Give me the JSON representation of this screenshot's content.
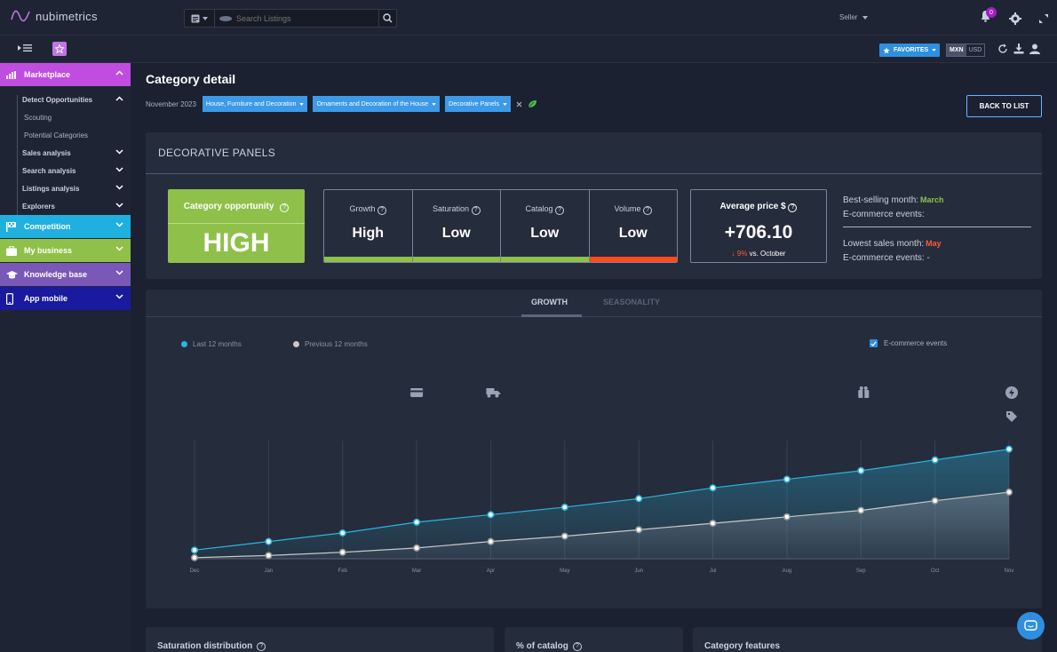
{
  "app": {
    "logo_text": "nubimetrics"
  },
  "topbar": {
    "search_placeholder": "Search Listings",
    "seller_label": "Seller",
    "notifications_count": "0"
  },
  "subbar": {
    "favorites_label": "FAVORITES",
    "currency_active": "MXN",
    "currency_other": "USD"
  },
  "sidebar": {
    "marketplace": "Marketplace",
    "detect_opportunities": "Detect Opportunities",
    "scouting": "Scouting",
    "potential_categories": "Potential Categories",
    "sales_analysis": "Sales analysis",
    "search_analysis": "Search analysis",
    "listings_analysis": "Listings analysis",
    "explorers": "Explorers",
    "competition": "Competition",
    "my_business": "My business",
    "knowledge_base": "Knowledge base",
    "app_mobile": "App mobile"
  },
  "main": {
    "title": "Category detail",
    "date": "November 2023",
    "crumbs": [
      "House, Furniture and Decoration",
      "Ornaments and Decoration of the House",
      "Decorative Panels"
    ],
    "back_label": "BACK TO LIST"
  },
  "summary": {
    "title": "DECORATIVE PANELS",
    "opportunity_label": "Category opportunity",
    "opportunity_value": "HIGH",
    "metrics": [
      {
        "label": "Growth",
        "value": "High"
      },
      {
        "label": "Saturation",
        "value": "Low"
      },
      {
        "label": "Catalog",
        "value": "Low"
      },
      {
        "label": "Volume",
        "value": "Low"
      }
    ],
    "avg_label": "Average price $",
    "avg_value": "+706.10",
    "avg_delta_pct": "9%",
    "avg_delta_text": "vs. October",
    "best_label": "Best-selling month:",
    "best_value": "March",
    "events_label": "E-commerce events:",
    "best_events_value": "-",
    "lowest_label": "Lowest sales month:",
    "lowest_value": "May",
    "lowest_events_value": "-"
  },
  "colors": {
    "accent_green": "#8fc04a",
    "accent_red": "#ff5a3c",
    "series_current": "#29b6e0",
    "series_previous": "#c8c8c8"
  },
  "chart_tabs": {
    "growth": "GROWTH",
    "seasonality": "SEASONALITY"
  },
  "chart_data": {
    "type": "area",
    "x": [
      "Dec",
      "Jan",
      "Feb",
      "Mar",
      "Apr",
      "May",
      "Jun",
      "Jul",
      "Aug",
      "Sep",
      "Oct",
      "Nov"
    ],
    "series": [
      {
        "name": "Last 12 months",
        "values": [
          8,
          16,
          24,
          34,
          41,
          48,
          56,
          66,
          74,
          82,
          92,
          102
        ]
      },
      {
        "name": "Previous 12 months",
        "values": [
          1,
          3,
          6,
          10,
          16,
          21,
          27,
          33,
          39,
          45,
          54,
          62
        ]
      }
    ],
    "ylim": [
      0,
      110
    ],
    "legend_position": "top-left",
    "events_checkbox_label": "E-commerce events",
    "event_icons": [
      {
        "month": "Mar",
        "icon": "credit-card-icon"
      },
      {
        "month": "Apr",
        "icon": "delivery-truck-icon"
      },
      {
        "month": "Sep",
        "icon": "gift-icon"
      },
      {
        "month": "Nov",
        "icon": "flash-icon"
      },
      {
        "month": "Nov",
        "icon": "tag-icon"
      }
    ]
  },
  "bottom": {
    "saturation": "Saturation distribution",
    "catalog": "% of catalog",
    "features": "Category features"
  }
}
